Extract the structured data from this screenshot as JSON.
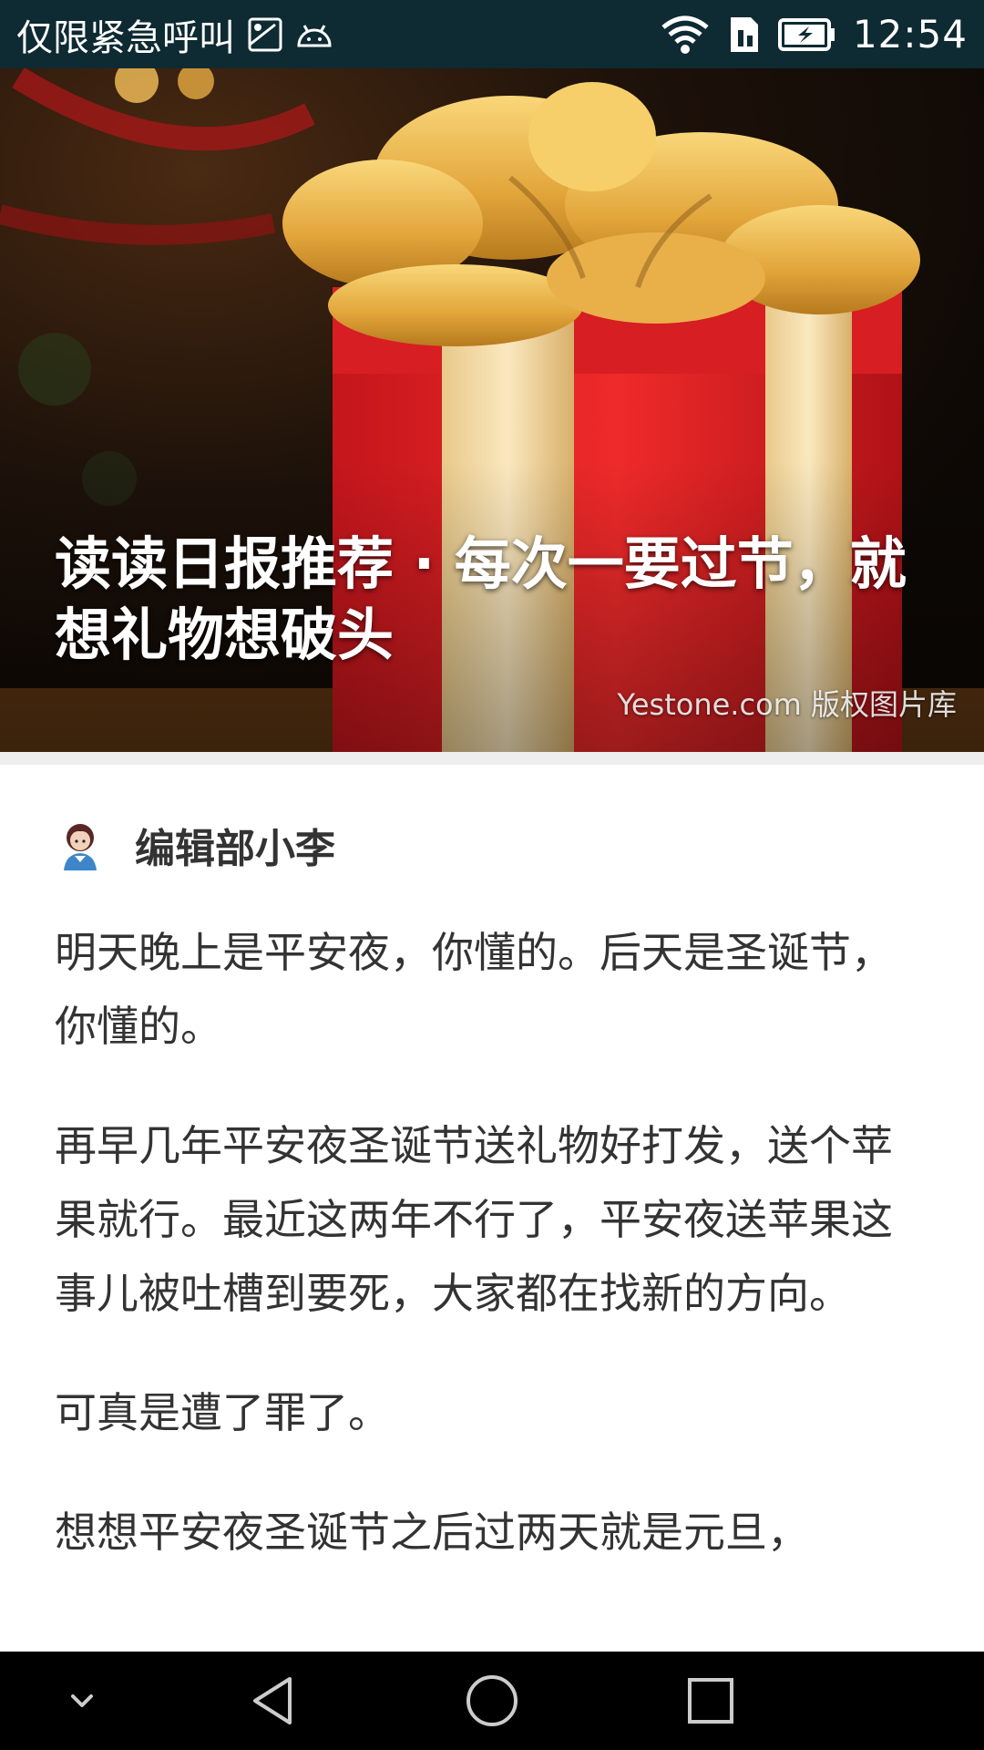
{
  "status_bar": {
    "carrier_text": "仅限紧急呼叫",
    "time": "12:54",
    "icons": [
      "gallery-icon",
      "android-icon",
      "wifi-icon",
      "sim-icon",
      "battery-icon"
    ]
  },
  "hero": {
    "title": "读读日报推荐 · 每次一要过节，就想礼物想破头",
    "image_credit": "Yestone.com 版权图片库"
  },
  "author": {
    "name": "编辑部小李"
  },
  "article": {
    "paragraphs": [
      "明天晚上是平安夜，你懂的。后天是圣诞节，你懂的。",
      "再早几年平安夜圣诞节送礼物好打发，送个苹果就行。最近这两年不行了，平安夜送苹果这事儿被吐槽到要死，大家都在找新的方向。",
      "可真是遭了罪了。",
      "想想平安夜圣诞节之后过两天就是元旦，"
    ]
  },
  "nav_bar": {
    "buttons": [
      "collapse-icon",
      "back-icon",
      "home-icon",
      "recents-icon"
    ]
  }
}
